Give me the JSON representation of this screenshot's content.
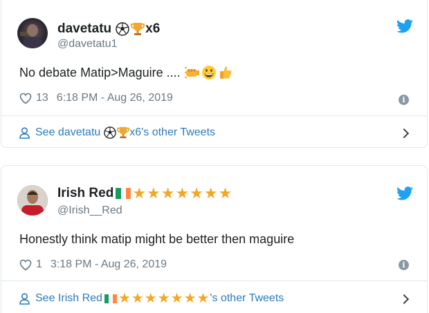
{
  "tweets": [
    {
      "display_name": "davetatu",
      "name_suffix": "x6",
      "handle": "@davetatu1",
      "text": "No debate Matip>Maguire ....",
      "likes": "13",
      "timestamp": "6:18 PM - Aug 26, 2019",
      "see_more_prefix": "See davetatu",
      "see_more_suffix": "x6's other Tweets"
    },
    {
      "display_name": "Irish Red",
      "name_stars": "★★★★★★★",
      "handle": "@Irish__Red",
      "text": "Honestly think matip might be better then maguire",
      "likes": "1",
      "timestamp": "3:18 PM - Aug 26, 2019",
      "see_more_prefix": "See Irish Red",
      "see_more_stars": "★★★★★★★",
      "see_more_suffix": "'s other Tweets"
    }
  ],
  "icons": {
    "info_glyph": "i"
  },
  "colors": {
    "twitter_blue": "#1da1f2",
    "link_blue": "#2b7bb9",
    "secondary_text": "#697882",
    "star_gold": "#f5a623",
    "flag_green": "#169b62",
    "flag_orange": "#ff883e"
  }
}
